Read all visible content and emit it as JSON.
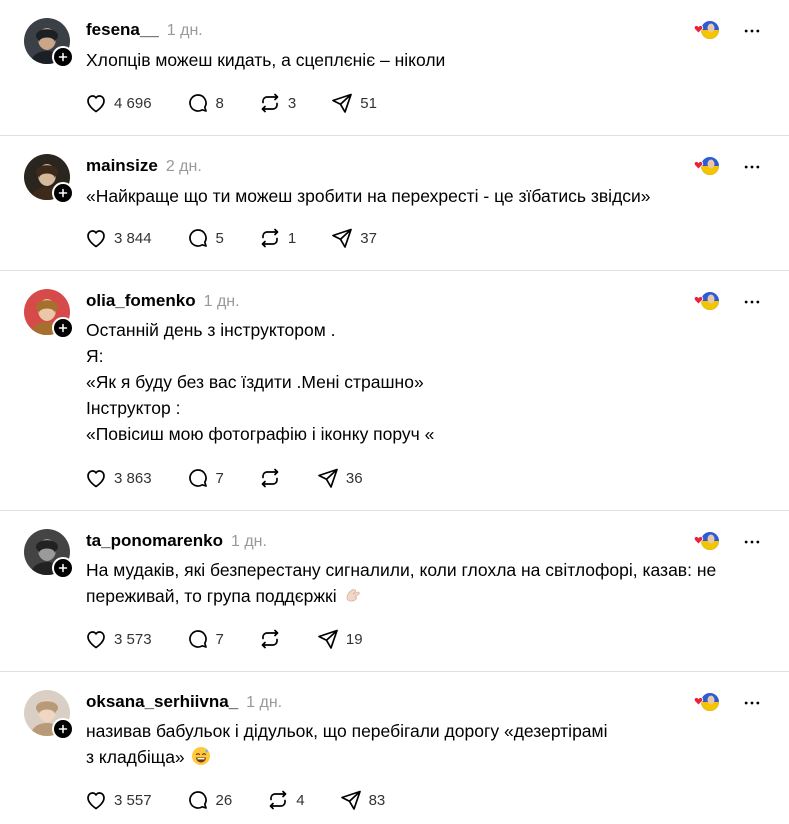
{
  "colors": {
    "text": "#000000",
    "muted": "#999999",
    "divider": "#e0e0e0",
    "heart": "#e8223a",
    "flag_blue": "#2c5bd4",
    "flag_yellow": "#f5c400"
  },
  "posts": [
    {
      "username": "fesena__",
      "time": "1 дн.",
      "lines": [
        "Хлопців можеш кидать, а сцеплєніє – ніколи"
      ],
      "emoji": "",
      "likes": "4 696",
      "replies": "8",
      "reposts": "3",
      "shares": "51"
    },
    {
      "username": "mainsize",
      "time": "2 дн.",
      "lines": [
        "«Найкраще що ти можеш зробити на перехресті - це зїбатись звідси»"
      ],
      "emoji": "",
      "likes": "3 844",
      "replies": "5",
      "reposts": "1",
      "shares": "37"
    },
    {
      "username": "olia_fomenko",
      "time": "1 дн.",
      "lines": [
        "Останній день з інструктором .",
        "Я:",
        "«Як я буду без вас їздити .Мені страшно»",
        "Інструктор :",
        "«Повісиш мою фотографію і іконку поруч «"
      ],
      "emoji": "",
      "likes": "3 863",
      "replies": "7",
      "reposts": "",
      "shares": "36"
    },
    {
      "username": "ta_ponomarenko",
      "time": "1 дн.",
      "lines": [
        "На мудаків, які безперестану сигналили, коли глохла на світлофорі, казав: не",
        "переживай, то група поддєржкі"
      ],
      "emoji": "wave-hand-emoji",
      "likes": "3 573",
      "replies": "7",
      "reposts": "",
      "shares": "19"
    },
    {
      "username": "oksana_serhiivna_",
      "time": "1 дн.",
      "lines": [
        "називав бабульок і дідульок, що перебігали дорогу «дезертірамі",
        "з кладбіща»"
      ],
      "emoji": "sweat-smile-emoji",
      "likes": "3 557",
      "replies": "26",
      "reposts": "4",
      "shares": "83"
    }
  ]
}
